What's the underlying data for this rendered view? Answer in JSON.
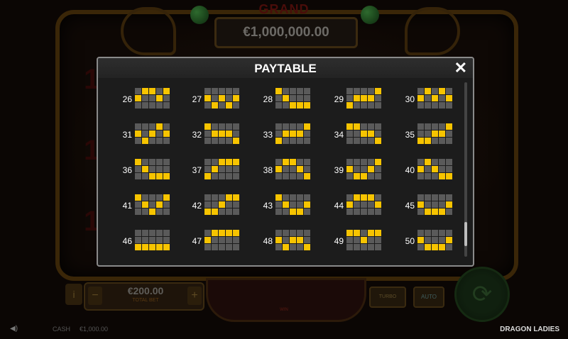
{
  "background": {
    "jackpot_title": "GRAND",
    "jackpot_value": "€1,000,000.00",
    "stake_value": "€200.00",
    "stake_label": "TOTAL BET",
    "spin_label": "WIN",
    "turbo_label": "TURBO",
    "auto_label": "AUTO",
    "info_label": "i"
  },
  "footer": {
    "cash_label": "CASH",
    "cash_value": "€1,000.00",
    "game_name": "DRAGON LADIES"
  },
  "paytable": {
    "title": "PAYTABLE",
    "close_icon": "close-icon",
    "scroll_position": 0.93,
    "accent_color": "#f7c400",
    "inactive_color": "#5a5a5a",
    "lines": [
      {
        "number": "26",
        "rows": [
          1,
          0,
          0,
          1,
          0
        ]
      },
      {
        "number": "27",
        "rows": [
          1,
          2,
          1,
          2,
          1
        ]
      },
      {
        "number": "28",
        "rows": [
          0,
          1,
          2,
          2,
          2
        ]
      },
      {
        "number": "29",
        "rows": [
          2,
          1,
          1,
          1,
          0
        ]
      },
      {
        "number": "30",
        "rows": [
          1,
          0,
          1,
          0,
          1
        ]
      },
      {
        "number": "31",
        "rows": [
          1,
          2,
          1,
          0,
          1
        ]
      },
      {
        "number": "32",
        "rows": [
          0,
          1,
          1,
          1,
          2
        ]
      },
      {
        "number": "33",
        "rows": [
          2,
          1,
          1,
          1,
          0
        ]
      },
      {
        "number": "34",
        "rows": [
          0,
          0,
          1,
          1,
          2
        ]
      },
      {
        "number": "35",
        "rows": [
          2,
          2,
          1,
          1,
          0
        ]
      },
      {
        "number": "36",
        "rows": [
          0,
          1,
          2,
          2,
          2
        ]
      },
      {
        "number": "37",
        "rows": [
          2,
          1,
          0,
          0,
          0
        ]
      },
      {
        "number": "38",
        "rows": [
          1,
          0,
          0,
          1,
          2
        ]
      },
      {
        "number": "39",
        "rows": [
          1,
          2,
          2,
          1,
          0
        ]
      },
      {
        "number": "40",
        "rows": [
          1,
          0,
          1,
          2,
          2
        ]
      },
      {
        "number": "41",
        "rows": [
          0,
          1,
          2,
          1,
          0
        ]
      },
      {
        "number": "42",
        "rows": [
          2,
          2,
          1,
          0,
          0
        ]
      },
      {
        "number": "43",
        "rows": [
          0,
          1,
          2,
          2,
          1
        ]
      },
      {
        "number": "44",
        "rows": [
          1,
          0,
          0,
          0,
          1
        ]
      },
      {
        "number": "45",
        "rows": [
          1,
          2,
          2,
          2,
          1
        ]
      },
      {
        "number": "46",
        "rows": [
          2,
          2,
          2,
          2,
          2
        ]
      },
      {
        "number": "47",
        "rows": [
          1,
          0,
          0,
          0,
          0
        ]
      },
      {
        "number": "48",
        "rows": [
          1,
          2,
          1,
          1,
          2
        ]
      },
      {
        "number": "49",
        "rows": [
          0,
          0,
          1,
          0,
          0
        ]
      },
      {
        "number": "50",
        "rows": [
          1,
          2,
          2,
          2,
          1
        ]
      }
    ]
  }
}
